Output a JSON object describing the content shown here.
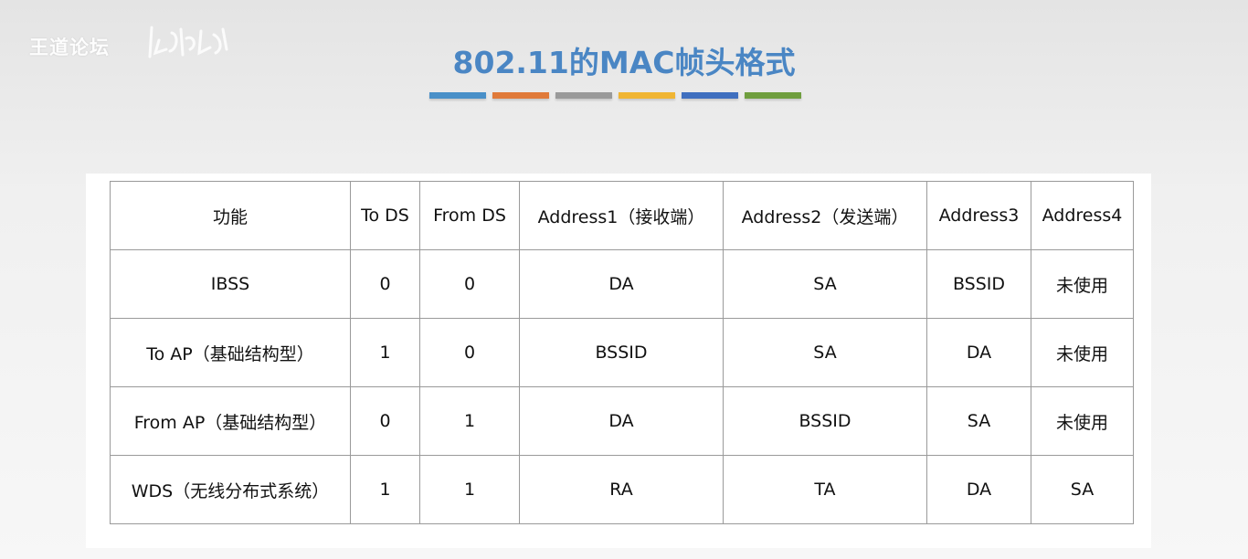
{
  "watermark": {
    "text": "王道论坛"
  },
  "title": "802.11的MAC帧头格式",
  "color_bars": [
    "#4a90c8",
    "#e07a3a",
    "#9a9a9a",
    "#f0b533",
    "#3f6fbf",
    "#6f9e3e"
  ],
  "table": {
    "header": [
      "功能",
      "To DS",
      "From DS",
      "Address1（接收端）",
      "Address2（发送端）",
      "Address3",
      "Address4"
    ],
    "rows": [
      [
        "IBSS",
        "0",
        "0",
        "DA",
        "SA",
        "BSSID",
        "未使用"
      ],
      [
        "To AP（基础结构型）",
        "1",
        "0",
        "BSSID",
        "SA",
        "DA",
        "未使用"
      ],
      [
        "From AP（基础结构型）",
        "0",
        "1",
        "DA",
        "BSSID",
        "SA",
        "未使用"
      ],
      [
        "WDS（无线分布式系统）",
        "1",
        "1",
        "RA",
        "TA",
        "DA",
        "SA"
      ]
    ]
  }
}
